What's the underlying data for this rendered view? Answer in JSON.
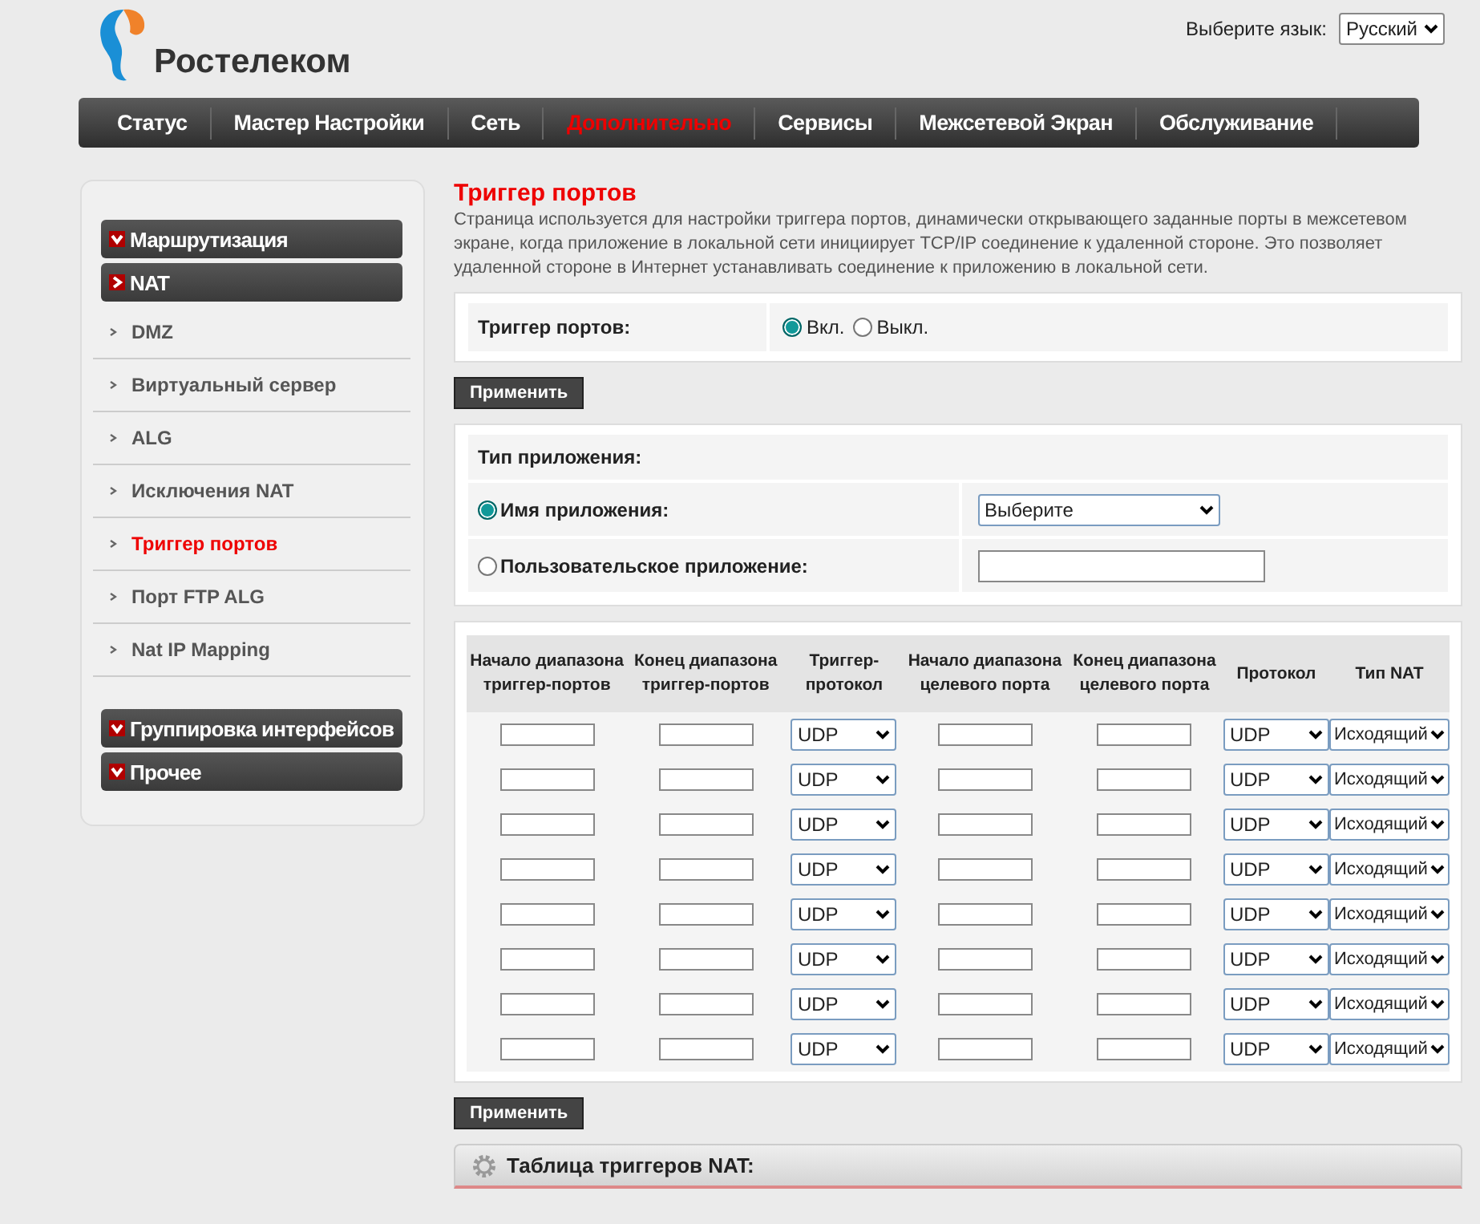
{
  "header": {
    "brand": "Ростелеком",
    "language_label": "Выберите язык:",
    "language": "Русский"
  },
  "nav": [
    {
      "label": "Статус",
      "selected": false
    },
    {
      "label": "Мастер Настройки",
      "selected": false
    },
    {
      "label": "Сеть",
      "selected": false
    },
    {
      "label": "Дополнительно",
      "selected": true
    },
    {
      "label": "Сервисы",
      "selected": false
    },
    {
      "label": "Межсетевой Экран",
      "selected": false
    },
    {
      "label": "Обслуживание",
      "selected": false
    }
  ],
  "sidebar": [
    {
      "label": "Маршрутизация",
      "expanded": false
    },
    {
      "label": "NAT",
      "expanded": true,
      "children": [
        {
          "label": "DMZ",
          "selected": false
        },
        {
          "label": "Виртуальный сервер",
          "selected": false
        },
        {
          "label": "ALG",
          "selected": false
        },
        {
          "label": "Исключения NAT",
          "selected": false
        },
        {
          "label": "Триггер портов",
          "selected": true
        },
        {
          "label": "Порт FTP ALG",
          "selected": false
        },
        {
          "label": "Nat IP Mapping",
          "selected": false
        }
      ]
    },
    {
      "label": "Группировка интерфейсов",
      "expanded": false
    },
    {
      "label": "Прочее",
      "expanded": false
    }
  ],
  "page": {
    "title": "Триггер портов",
    "description": "Страница используется для настройки триггера портов, динамически открывающего заданные порты в межсетевом экране, когда приложение в локальной сети инициирует TCP/IP соединение к удаленной стороне. Это позволяет удаленной стороне в Интернет устанавливать соединение к приложению в локальной сети."
  },
  "trigger": {
    "label": "Триггер портов:",
    "options": [
      {
        "label": "Вкл.",
        "selected": true
      },
      {
        "label": "Выкл.",
        "selected": false
      }
    ]
  },
  "apply_button": "Применить",
  "app_type": {
    "label": "Тип приложения:",
    "options": [
      {
        "label": "Имя приложения:",
        "selected": true,
        "kind": "select",
        "value": "Выберите"
      },
      {
        "label": "Пользовательское приложение:",
        "selected": false,
        "kind": "input"
      }
    ]
  },
  "table": {
    "columns": [
      "Начало диапазона триггер-портов",
      "Конец диапазона триггер-портов",
      "Триггер-протокол",
      "Начало диапазона целевого порта",
      "Конец диапазона целевого порта",
      "Протокол",
      "Тип NAT"
    ],
    "rows": [
      {
        "trigger_protocol": "UDP",
        "protocol": "UDP",
        "nat_type": "Исходящий"
      },
      {
        "trigger_protocol": "UDP",
        "protocol": "UDP",
        "nat_type": "Исходящий"
      },
      {
        "trigger_protocol": "UDP",
        "protocol": "UDP",
        "nat_type": "Исходящий"
      },
      {
        "trigger_protocol": "UDP",
        "protocol": "UDP",
        "nat_type": "Исходящий"
      },
      {
        "trigger_protocol": "UDP",
        "protocol": "UDP",
        "nat_type": "Исходящий"
      },
      {
        "trigger_protocol": "UDP",
        "protocol": "UDP",
        "nat_type": "Исходящий"
      },
      {
        "trigger_protocol": "UDP",
        "protocol": "UDP",
        "nat_type": "Исходящий"
      },
      {
        "trigger_protocol": "UDP",
        "protocol": "UDP",
        "nat_type": "Исходящий"
      }
    ]
  },
  "apply_button_2": "Применить",
  "nat_table": {
    "title": "Таблица триггеров NAT:"
  }
}
